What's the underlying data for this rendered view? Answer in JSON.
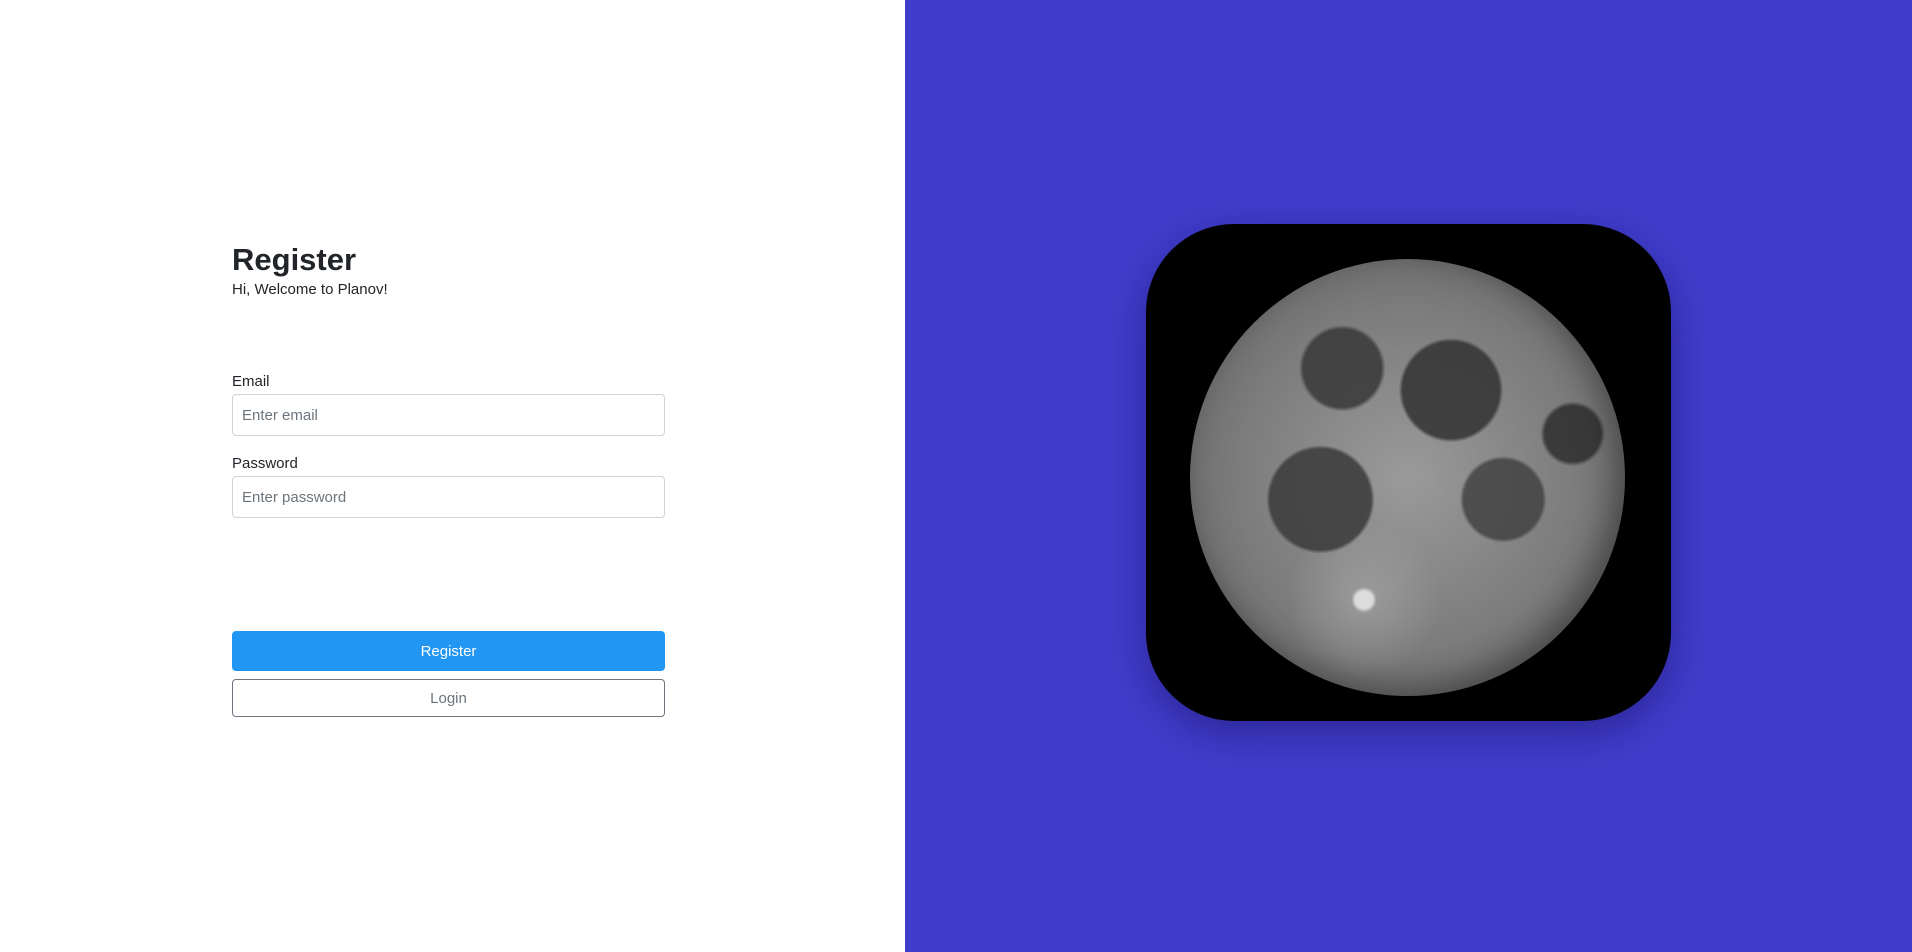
{
  "form": {
    "title": "Register",
    "subtitle": "Hi, Welcome to Planov!",
    "email": {
      "label": "Email",
      "placeholder": "Enter email",
      "value": ""
    },
    "password": {
      "label": "Password",
      "placeholder": "Enter password",
      "value": ""
    },
    "register_button": "Register",
    "login_button": "Login"
  },
  "colors": {
    "right_panel_bg": "#403dcd",
    "primary_button_bg": "#2196f3",
    "primary_button_text": "#ffffff",
    "card_bg": "#000000"
  },
  "hero": {
    "icon": "moon-icon"
  }
}
